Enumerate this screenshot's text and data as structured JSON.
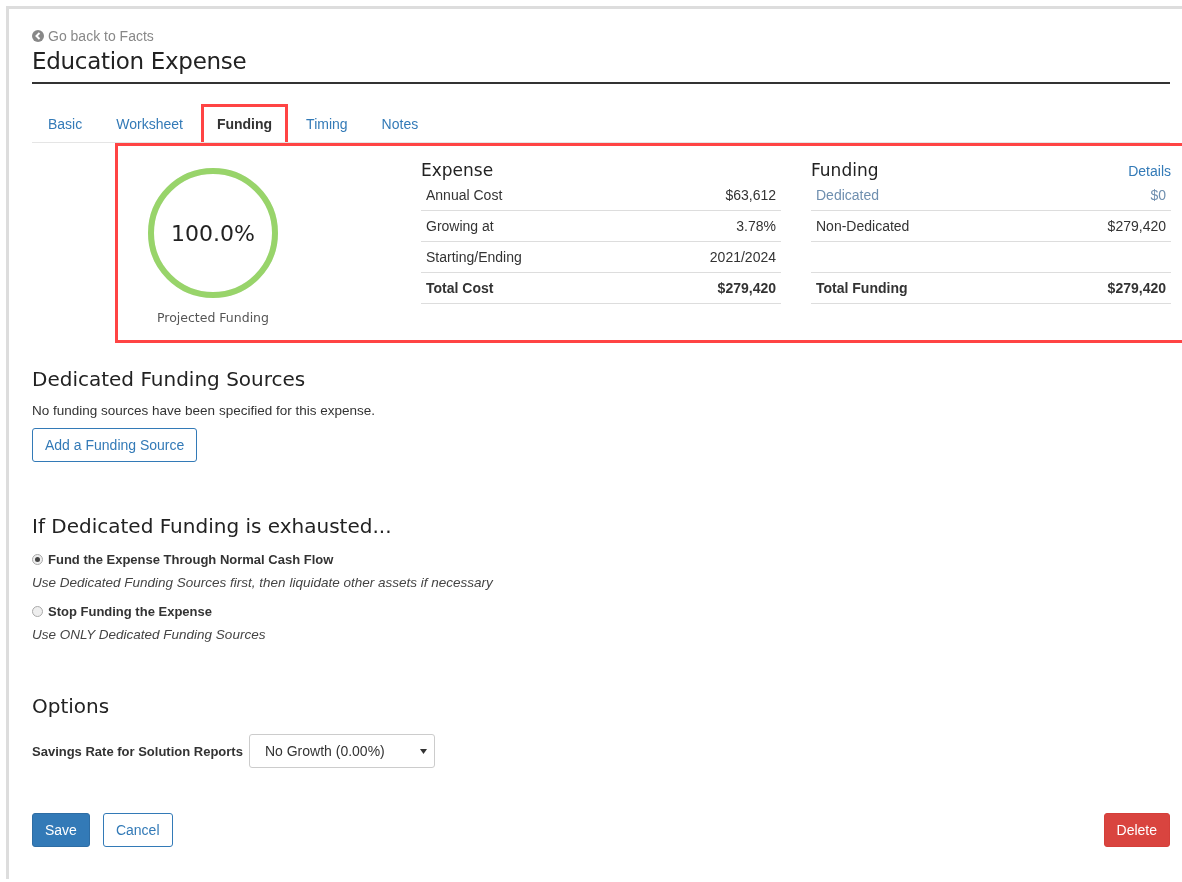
{
  "back_link": "Go back to Facts",
  "title": "Education Expense",
  "tabs": [
    {
      "label": "Basic",
      "selected": false
    },
    {
      "label": "Worksheet",
      "selected": false
    },
    {
      "label": "Funding",
      "selected": true
    },
    {
      "label": "Timing",
      "selected": false
    },
    {
      "label": "Notes",
      "selected": false
    }
  ],
  "summary": {
    "ring": {
      "percent": "100.0%",
      "label": "Projected Funding",
      "level": 1
    },
    "expense": {
      "title": "Expense",
      "rows": [
        {
          "kind": "normal",
          "label": "Annual Cost",
          "value": "$63,612"
        },
        {
          "kind": "normal",
          "label": "Growing at",
          "value": "3.78%"
        },
        {
          "kind": "normal",
          "label": "Starting/Ending",
          "value": "2021/2024"
        },
        {
          "kind": "total",
          "label": "Total Cost",
          "value": "$279,420"
        }
      ]
    },
    "funding": {
      "title": "Funding",
      "details_link": "Details",
      "rows": [
        {
          "kind": "link",
          "label": "Dedicated",
          "value": "$0"
        },
        {
          "kind": "normal",
          "label": "Non-Dedicated",
          "value": "$279,420"
        },
        {
          "kind": "blank"
        },
        {
          "kind": "total",
          "label": "Total Funding",
          "value": "$279,420"
        }
      ]
    }
  },
  "dedicated": {
    "heading": "Dedicated Funding Sources",
    "message": "No funding sources have been specified for this expense.",
    "add_button": "Add a Funding Source"
  },
  "exhausted": {
    "heading": "If Dedicated Funding is exhausted...",
    "options": [
      {
        "label": "Fund the Expense Through Normal Cash Flow",
        "hint": "Use Dedicated Funding Sources first, then liquidate other assets if necessary",
        "selected": true
      },
      {
        "label": "Stop Funding the Expense",
        "hint": "Use ONLY Dedicated Funding Sources",
        "selected": false
      }
    ]
  },
  "options": {
    "heading": "Options",
    "field_label": "Savings Rate for Solution Reports",
    "select_value": "No Growth (0.00%)"
  },
  "buttons": {
    "save": "Save",
    "cancel": "Cancel",
    "delete": "Delete"
  }
}
